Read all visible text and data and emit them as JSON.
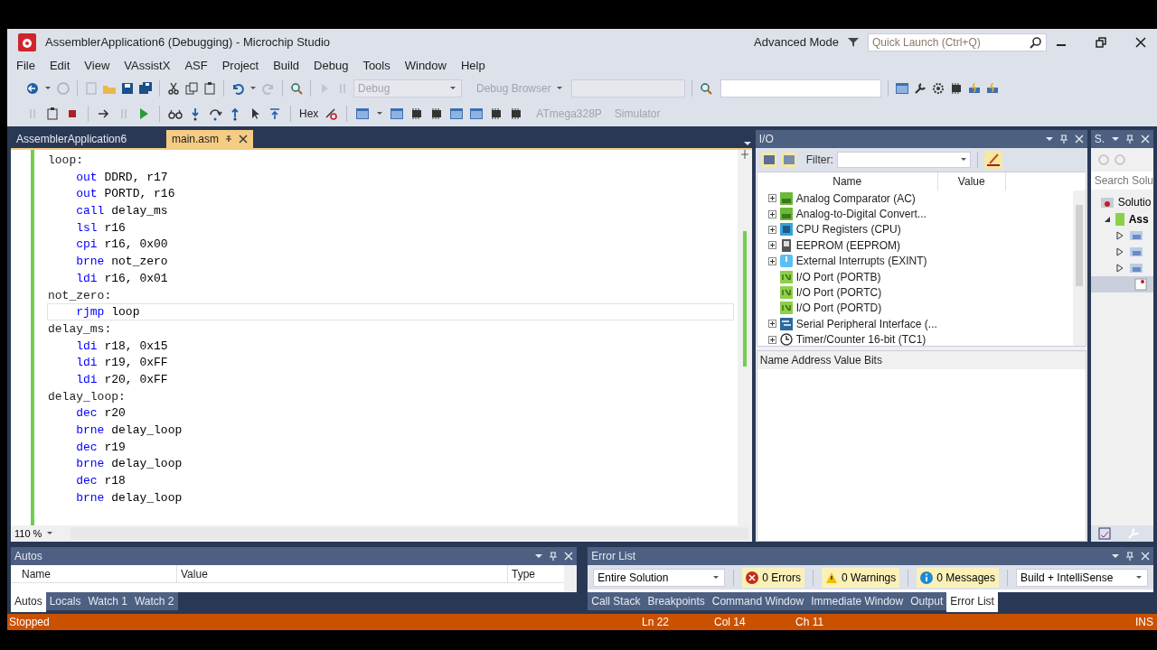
{
  "window": {
    "title": "AssemblerApplication6 (Debugging) - Microchip Studio",
    "mode": "Advanced Mode",
    "quick_launch": {
      "placeholder": "Quick Launch (Ctrl+Q)"
    }
  },
  "menu": [
    "File",
    "Edit",
    "View",
    "VAssistX",
    "ASF",
    "Project",
    "Build",
    "Debug",
    "Tools",
    "Window",
    "Help"
  ],
  "toolbar": {
    "configuration": {
      "value": "Debug",
      "disabled": true
    },
    "debug_browser": {
      "label": "Debug Browser",
      "disabled": true
    },
    "hex": "Hex",
    "device": {
      "label": "ATmega328P",
      "disabled": true
    },
    "tool": {
      "label": "Simulator",
      "disabled": true
    }
  },
  "editor": {
    "tabs": [
      {
        "label": "AssemblerApplication6",
        "selected": false
      },
      {
        "label": "main.asm",
        "selected": true
      }
    ],
    "lines": [
      {
        "kind": "label",
        "text": "loop:",
        "current": false
      },
      {
        "kind": "instr",
        "op": "out",
        "args": "DDRD, r17",
        "current": false
      },
      {
        "kind": "instr",
        "op": "out",
        "args": "PORTD, r16",
        "current": false
      },
      {
        "kind": "instr",
        "op": "call",
        "args": "delay_ms",
        "current": false
      },
      {
        "kind": "instr",
        "op": "lsl",
        "args": "r16",
        "current": false
      },
      {
        "kind": "instr",
        "op": "cpi",
        "args": "r16, 0x00",
        "current": false
      },
      {
        "kind": "instr",
        "op": "brne",
        "args": "not_zero",
        "current": false
      },
      {
        "kind": "instr",
        "op": "ldi",
        "args": "r16, 0x01",
        "current": false
      },
      {
        "kind": "label",
        "text": "not_zero:",
        "current": false
      },
      {
        "kind": "instr",
        "op": "rjmp",
        "args": "loop",
        "current": true
      },
      {
        "kind": "label",
        "text": "delay_ms:",
        "current": false
      },
      {
        "kind": "instr",
        "op": "ldi",
        "args": "r18, 0x15",
        "current": false
      },
      {
        "kind": "instr",
        "op": "ldi",
        "args": "r19, 0xFF",
        "current": false
      },
      {
        "kind": "instr",
        "op": "ldi",
        "args": "r20, 0xFF",
        "current": false
      },
      {
        "kind": "label",
        "text": "delay_loop:",
        "current": false
      },
      {
        "kind": "instr",
        "op": "dec",
        "args": "r20",
        "current": false
      },
      {
        "kind": "instr",
        "op": "brne",
        "args": "delay_loop",
        "current": false
      },
      {
        "kind": "instr",
        "op": "dec",
        "args": "r19",
        "current": false
      },
      {
        "kind": "instr",
        "op": "brne",
        "args": "delay_loop",
        "current": false
      },
      {
        "kind": "instr",
        "op": "dec",
        "args": "r18",
        "current": false
      },
      {
        "kind": "instr",
        "op": "brne",
        "args": "delay_loop",
        "current": false
      }
    ],
    "zoom": "110 %"
  },
  "io": {
    "title": "I/O",
    "filter_label": "Filter:",
    "columns": [
      "Name",
      "Value"
    ],
    "items": [
      {
        "kind": "group",
        "label": "Analog Comparator (AC)"
      },
      {
        "kind": "group",
        "label": "Analog-to-Digital Convert..."
      },
      {
        "kind": "group",
        "label": "CPU Registers (CPU)"
      },
      {
        "kind": "group",
        "label": "EEPROM (EEPROM)"
      },
      {
        "kind": "group",
        "label": "External Interrupts (EXINT)"
      },
      {
        "kind": "leaf",
        "label": "I/O Port (PORTB)"
      },
      {
        "kind": "leaf",
        "label": "I/O Port (PORTC)"
      },
      {
        "kind": "leaf",
        "label": "I/O Port (PORTD)"
      },
      {
        "kind": "group",
        "label": "Serial Peripheral Interface (..."
      },
      {
        "kind": "group",
        "label": "Timer/Counter 16-bit (TC1)"
      }
    ],
    "details_header": "Name Address Value Bits"
  },
  "solution": {
    "title": "S.",
    "search": {
      "placeholder": "Search Solu"
    },
    "root": "Solutio",
    "project": "Ass",
    "children": [
      {
        "kind": "folder",
        "selected": false
      },
      {
        "kind": "folder",
        "selected": false
      },
      {
        "kind": "folder",
        "selected": false
      },
      {
        "kind": "file",
        "selected": true
      }
    ]
  },
  "autos": {
    "title": "Autos",
    "columns": [
      "Name",
      "Value",
      "Type"
    ],
    "tabs": [
      {
        "label": "Autos",
        "selected": true
      },
      {
        "label": "Locals",
        "selected": false
      },
      {
        "label": "Watch 1",
        "selected": false
      },
      {
        "label": "Watch 2",
        "selected": false
      }
    ]
  },
  "error_list": {
    "title": "Error List",
    "scope": "Entire Solution",
    "errors": "0 Errors",
    "warnings": "0 Warnings",
    "messages": "0 Messages",
    "source": "Build + IntelliSense",
    "tabs": [
      {
        "label": "Call Stack",
        "selected": false
      },
      {
        "label": "Breakpoints",
        "selected": false
      },
      {
        "label": "Command Window",
        "selected": false
      },
      {
        "label": "Immediate Window",
        "selected": false
      },
      {
        "label": "Output",
        "selected": false
      },
      {
        "label": "Error List",
        "selected": true
      }
    ]
  },
  "status_bar": {
    "state": "Stopped",
    "line": "Ln 22",
    "column": "Col 14",
    "char": "Ch 11",
    "mode": "INS"
  }
}
